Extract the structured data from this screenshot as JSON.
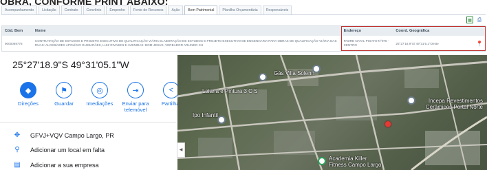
{
  "page": {
    "heading": "OBRA, CONFORME PRINT ABAIXO:"
  },
  "tabs": [
    {
      "label": "Acompanhamento"
    },
    {
      "label": "Licitação"
    },
    {
      "label": "Contrato"
    },
    {
      "label": "Convênio"
    },
    {
      "label": "Empenho"
    },
    {
      "label": "Fonte de Recursos"
    },
    {
      "label": "Ação"
    },
    {
      "label": "Bem Patrimonial",
      "active": true
    },
    {
      "label": "Planilha Orçamentária"
    },
    {
      "label": "Responsáveis"
    }
  ],
  "toolbar": {
    "excel_icon": "excel-export-icon",
    "print_icon": "print-icon"
  },
  "table": {
    "headers": {
      "cod": "Cód. Bem",
      "nome": "Nome",
      "endereco": "Endereço",
      "coord": "Coord. Geográfica"
    },
    "row": {
      "cod": "9000069775",
      "nome": "CONTRATAÇÃO DE ESTUDOS E PROJETO EXECUTIVO DE QUALIFICAÇÃO VIÁRIA ELABORAÇÃO DE ESTUDOS E PROJETO EXECUTIVO DE ENGENHARIA PARA OBRAS DE QUALIFICAÇÃO VIÁRIA DAS RUAS: ALCEBÍADES APOLÍGIO GUIMARÃES, LUIZ RIVABEN E AVENIDAS: BOM JESUS, VEREADOR ARLINDO CH",
      "endereco": "PADRE NATAL PIGATO N°975 - CENTRO",
      "coord": "25°27'18.9\"S/ 49°31'5.1\"Oeste"
    }
  },
  "maps_panel": {
    "coordinates": "25°27'18.9\"S 49°31'05.1\"W",
    "actions": [
      {
        "label": "Direções",
        "icon": "directions-icon"
      },
      {
        "label": "Guardar",
        "icon": "bookmark-icon"
      },
      {
        "label": "Imediações",
        "icon": "nearby-icon"
      },
      {
        "label": "Enviar para telemóvel",
        "icon": "send-to-phone-icon"
      },
      {
        "label": "Partilhar",
        "icon": "share-icon"
      }
    ],
    "info": [
      {
        "text": "GFVJ+VQV Campo Largo, PR",
        "icon": "plus-code-icon"
      },
      {
        "text": "Adicionar um local em falta",
        "icon": "add-place-icon"
      },
      {
        "text": "Adicionar a sua empresa",
        "icon": "business-icon"
      }
    ]
  },
  "map": {
    "labels": [
      "Lalana e Pintura 3 C S",
      "Gás Villa Solenn",
      "Ipo Infantil",
      "Incepa Revestimentos Cerâmicos Portal Norte",
      "Academia Killer Fitness Campo Largo"
    ],
    "pin_color": "#e53935"
  }
}
